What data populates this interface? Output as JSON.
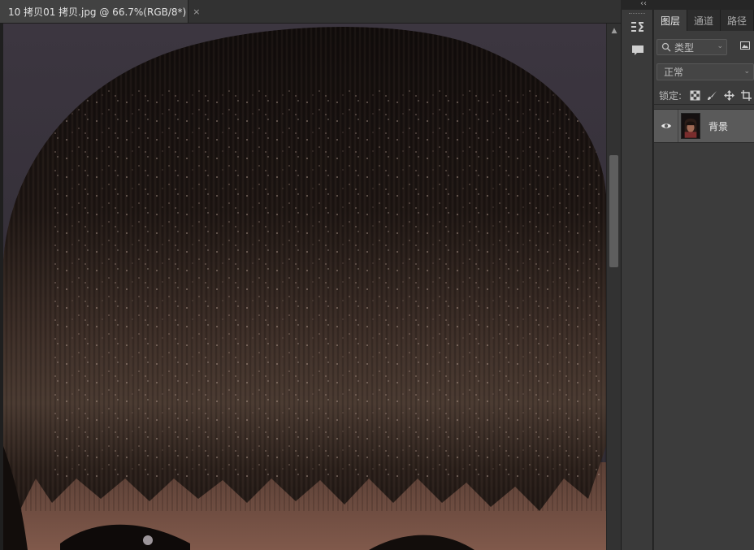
{
  "document": {
    "tab_title": "10 拷贝01 拷贝.jpg @ 66.7%(RGB/8*)",
    "close_glyph": "×"
  },
  "scrollbar": {
    "up_arrow_glyph": "▲"
  },
  "strip": {
    "collapse_glyph": "‹‹"
  },
  "tool_strip": {
    "icons": [
      "paragraph-icon",
      "comment-icon"
    ]
  },
  "layers_panel": {
    "tabs": [
      {
        "label": "图层",
        "active": true
      },
      {
        "label": "通道",
        "active": false
      },
      {
        "label": "路径",
        "active": false
      }
    ],
    "filter": {
      "label": "类型",
      "icon": "search-icon",
      "chevron": "⌄"
    },
    "blend_mode": {
      "value": "正常",
      "chevron": "⌄"
    },
    "lock": {
      "label": "锁定:",
      "icons": [
        "lock-transparent-icon",
        "lock-paint-icon",
        "lock-move-icon",
        "lock-artboard-icon"
      ]
    },
    "layers": [
      {
        "name": "背景",
        "visible": true,
        "selected": true
      }
    ]
  },
  "colors": {
    "panel_bg": "#3c3c3c",
    "selected_layer": "#5a5a5a",
    "canvas_bg": "#1f1f1f",
    "hair_dark": "#1b1412",
    "skin": "#6e4a3e"
  }
}
